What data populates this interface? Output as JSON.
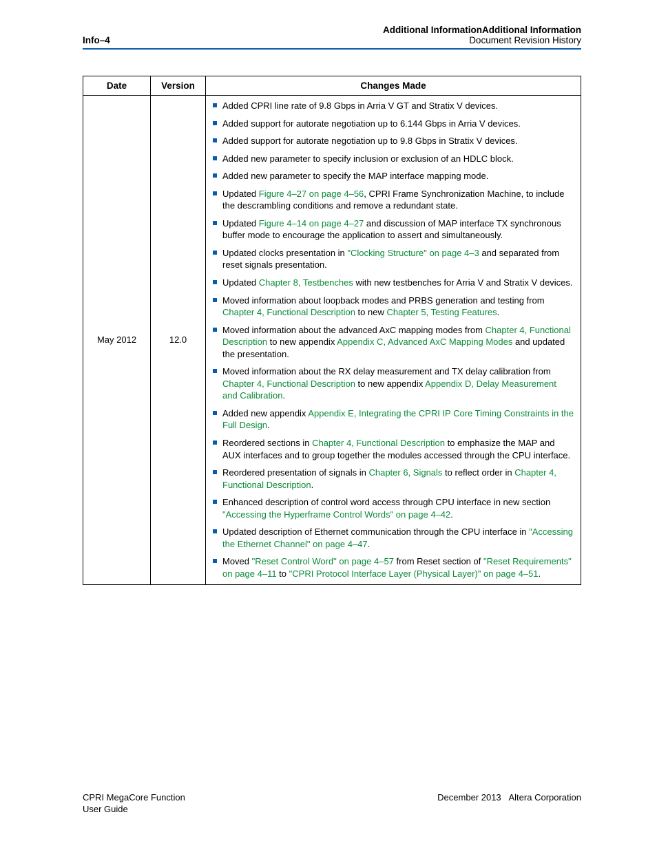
{
  "header": {
    "left": "Info–4",
    "right_bold": "Additional InformationAdditional Information",
    "right_sub": "Document Revision History"
  },
  "table": {
    "columns": {
      "date": "Date",
      "version": "Version",
      "changes": "Changes Made"
    },
    "row": {
      "date": "May 2012",
      "version": "12.0",
      "items": [
        {
          "segments": [
            {
              "t": "Added CPRI line rate of 9.8 Gbps in Arria V GT and Stratix V devices."
            }
          ]
        },
        {
          "segments": [
            {
              "t": "Added support for autorate negotiation up to 6.144 Gbps in Arria V devices."
            }
          ]
        },
        {
          "segments": [
            {
              "t": "Added support for autorate negotiation up to 9.8 Gbps in Stratix V devices."
            }
          ]
        },
        {
          "segments": [
            {
              "t": "Added new parameter to specify inclusion or exclusion of an HDLC block."
            }
          ]
        },
        {
          "segments": [
            {
              "t": "Added new parameter to specify the MAP interface mapping mode."
            }
          ]
        },
        {
          "segments": [
            {
              "t": "Updated "
            },
            {
              "t": "Figure 4–27 on page 4–56",
              "link": true
            },
            {
              "t": ", CPRI Frame Synchronization Machine, to include the descrambling conditions and remove a redundant state."
            }
          ]
        },
        {
          "segments": [
            {
              "t": "Updated "
            },
            {
              "t": "Figure 4–14 on page 4–27",
              "link": true
            },
            {
              "t": " and discussion of MAP interface TX synchronous buffer mode to encourage the application to assert                                      and                             simultaneously."
            }
          ]
        },
        {
          "segments": [
            {
              "t": "Updated clocks presentation in "
            },
            {
              "t": "\"Clocking Structure\" on page 4–3",
              "link": true
            },
            {
              "t": " and separated from reset signals presentation."
            }
          ]
        },
        {
          "segments": [
            {
              "t": "Updated "
            },
            {
              "t": "Chapter 8, Testbenches",
              "link": true
            },
            {
              "t": " with new testbenches for Arria V and Stratix V devices."
            }
          ]
        },
        {
          "segments": [
            {
              "t": "Moved information about loopback modes and PRBS generation and testing from "
            },
            {
              "t": "Chapter 4, Functional Description",
              "link": true
            },
            {
              "t": " to new "
            },
            {
              "t": "Chapter 5, Testing Features",
              "link": true
            },
            {
              "t": "."
            }
          ]
        },
        {
          "segments": [
            {
              "t": "Moved information about the advanced AxC mapping modes from "
            },
            {
              "t": "Chapter 4, Functional Description",
              "link": true
            },
            {
              "t": " to new appendix "
            },
            {
              "t": "Appendix C, Advanced AxC Mapping Modes",
              "link": true
            },
            {
              "t": " and updated the presentation."
            }
          ]
        },
        {
          "segments": [
            {
              "t": "Moved information about the RX delay measurement and TX delay calibration from "
            },
            {
              "t": "Chapter 4, Functional Description",
              "link": true
            },
            {
              "t": " to new appendix "
            },
            {
              "t": "Appendix D, Delay Measurement and Calibration",
              "link": true
            },
            {
              "t": "."
            }
          ]
        },
        {
          "segments": [
            {
              "t": "Added new appendix "
            },
            {
              "t": "Appendix E, Integrating the CPRI IP Core Timing Constraints in the Full Design",
              "link": true
            },
            {
              "t": "."
            }
          ]
        },
        {
          "segments": [
            {
              "t": "Reordered sections in "
            },
            {
              "t": "Chapter 4, Functional Description",
              "link": true
            },
            {
              "t": " to emphasize the MAP and AUX interfaces and to group together the modules accessed through the CPU interface."
            }
          ]
        },
        {
          "segments": [
            {
              "t": "Reordered presentation of signals in "
            },
            {
              "t": "Chapter 6, Signals",
              "link": true
            },
            {
              "t": " to reflect order in "
            },
            {
              "t": "Chapter 4, Functional Description",
              "link": true
            },
            {
              "t": "."
            }
          ]
        },
        {
          "segments": [
            {
              "t": "Enhanced description of control word access through CPU interface in new section "
            },
            {
              "t": "\"Accessing the Hyperframe Control Words\" on page 4–42",
              "link": true
            },
            {
              "t": "."
            }
          ]
        },
        {
          "segments": [
            {
              "t": "Updated description of Ethernet communication through the CPU interface in "
            },
            {
              "t": "\"Accessing the Ethernet Channel\" on page 4–47",
              "link": true
            },
            {
              "t": "."
            }
          ]
        },
        {
          "segments": [
            {
              "t": "Moved "
            },
            {
              "t": "\"Reset Control Word\" on page 4–57",
              "link": true
            },
            {
              "t": " from Reset section of "
            },
            {
              "t": "\"Reset Requirements\" on page 4–11",
              "link": true
            },
            {
              "t": " to "
            },
            {
              "t": "\"CPRI Protocol Interface Layer (Physical Layer)\" on page 4–51",
              "link": true
            },
            {
              "t": "."
            }
          ]
        }
      ]
    }
  },
  "footer": {
    "left_line1": "CPRI MegaCore Function",
    "left_line2": "User Guide",
    "right_date": "December 2013",
    "right_org": "Altera Corporation"
  }
}
